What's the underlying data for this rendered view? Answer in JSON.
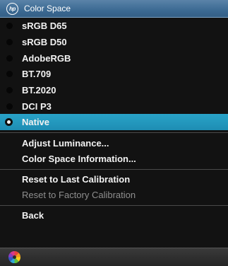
{
  "header": {
    "logo_text": "hp",
    "title": "Color Space"
  },
  "menu": {
    "color_spaces": [
      {
        "label": "sRGB D65",
        "selected": false
      },
      {
        "label": "sRGB D50",
        "selected": false
      },
      {
        "label": "AdobeRGB",
        "selected": false
      },
      {
        "label": "BT.709",
        "selected": false
      },
      {
        "label": "BT.2020",
        "selected": false
      },
      {
        "label": "DCI P3",
        "selected": false
      },
      {
        "label": "Native",
        "selected": true
      }
    ],
    "adjust_luminance": "Adjust Luminance...",
    "color_space_information": "Color Space Information...",
    "reset_last_calibration": "Reset to Last Calibration",
    "reset_factory_calibration": "Reset to Factory Calibration",
    "back": "Back"
  },
  "footer": {
    "icon": "pinwheel-icon"
  },
  "colors": {
    "header": "#3c6a93",
    "selected_highlight": "#1e8db3",
    "disabled_text": "#8e8e8e",
    "text": "#f2f2f2"
  }
}
